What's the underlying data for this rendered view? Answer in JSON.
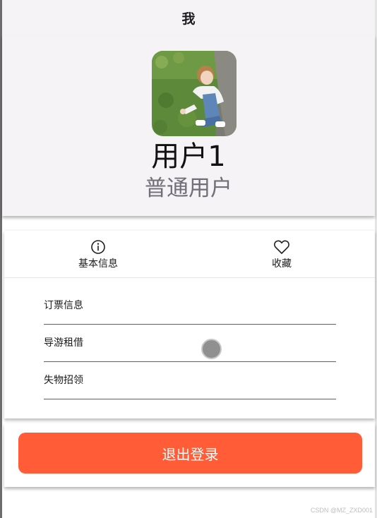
{
  "appbar": {
    "title": "我"
  },
  "profile": {
    "username": "用户1",
    "user_type": "普通用户",
    "avatar_icon": "user-photo-avatar"
  },
  "actions": [
    {
      "label": "基本信息",
      "icon": "info-circle-icon"
    },
    {
      "label": "收藏",
      "icon": "heart-outline-icon"
    }
  ],
  "menu": [
    {
      "label": "订票信息"
    },
    {
      "label": "导游租借"
    },
    {
      "label": "失物招领"
    }
  ],
  "logout": {
    "label": "退出登录",
    "color": "#ff5c37"
  },
  "watermark": "CSDN @MZ_ZXD001",
  "colors": {
    "header_bg": "#f6f3f6",
    "accent": "#ff5c37",
    "divider": "#5f5f5f"
  }
}
